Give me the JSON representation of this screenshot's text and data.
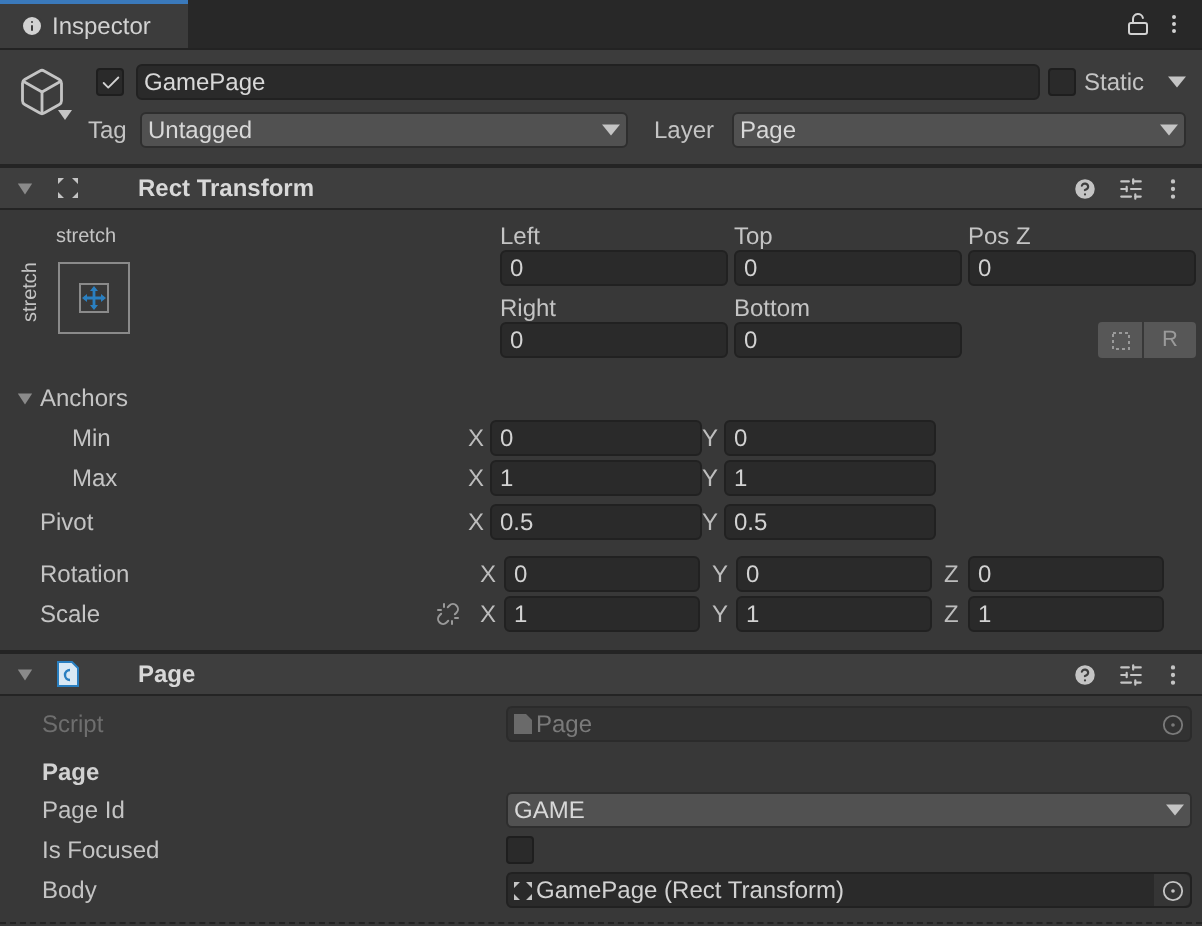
{
  "tab": {
    "title": "Inspector"
  },
  "header": {
    "active": true,
    "name": "GamePage",
    "static": {
      "label": "Static",
      "checked": false
    },
    "tag": {
      "label": "Tag",
      "value": "Untagged"
    },
    "layer": {
      "label": "Layer",
      "value": "Page"
    }
  },
  "rect_transform": {
    "title": "Rect Transform",
    "expanded": true,
    "preset": {
      "horizontal": "stretch",
      "vertical": "stretch"
    },
    "offsets": [
      {
        "label": "Left",
        "value": "0"
      },
      {
        "label": "Top",
        "value": "0"
      },
      {
        "label": "Pos Z",
        "value": "0"
      },
      {
        "label": "Right",
        "value": "0"
      },
      {
        "label": "Bottom",
        "value": "0"
      }
    ],
    "raw_button": "R",
    "anchors": {
      "label": "Anchors",
      "expanded": true,
      "rows": [
        {
          "label": "Min",
          "fields": [
            {
              "axis": "X",
              "value": "0"
            },
            {
              "axis": "Y",
              "value": "0"
            }
          ]
        },
        {
          "label": "Max",
          "fields": [
            {
              "axis": "X",
              "value": "1"
            },
            {
              "axis": "Y",
              "value": "1"
            }
          ]
        }
      ]
    },
    "pivot": {
      "label": "Pivot",
      "fields": [
        {
          "axis": "X",
          "value": "0.5"
        },
        {
          "axis": "Y",
          "value": "0.5"
        }
      ]
    },
    "rotation": {
      "label": "Rotation",
      "fields": [
        {
          "axis": "X",
          "value": "0"
        },
        {
          "axis": "Y",
          "value": "0"
        },
        {
          "axis": "Z",
          "value": "0"
        }
      ]
    },
    "scale": {
      "label": "Scale",
      "constrained": false,
      "fields": [
        {
          "axis": "X",
          "value": "1"
        },
        {
          "axis": "Y",
          "value": "1"
        },
        {
          "axis": "Z",
          "value": "1"
        }
      ]
    }
  },
  "page_component": {
    "title": "Page",
    "expanded": true,
    "script": {
      "label": "Script",
      "value": "Page",
      "disabled": true
    },
    "section": "Page",
    "fields": [
      {
        "kind": "dropdown",
        "label": "Page Id",
        "value": "GAME"
      },
      {
        "kind": "checkbox",
        "label": "Is Focused",
        "checked": false
      },
      {
        "kind": "object",
        "label": "Body",
        "value": "GamePage (Rect Transform)"
      }
    ]
  }
}
